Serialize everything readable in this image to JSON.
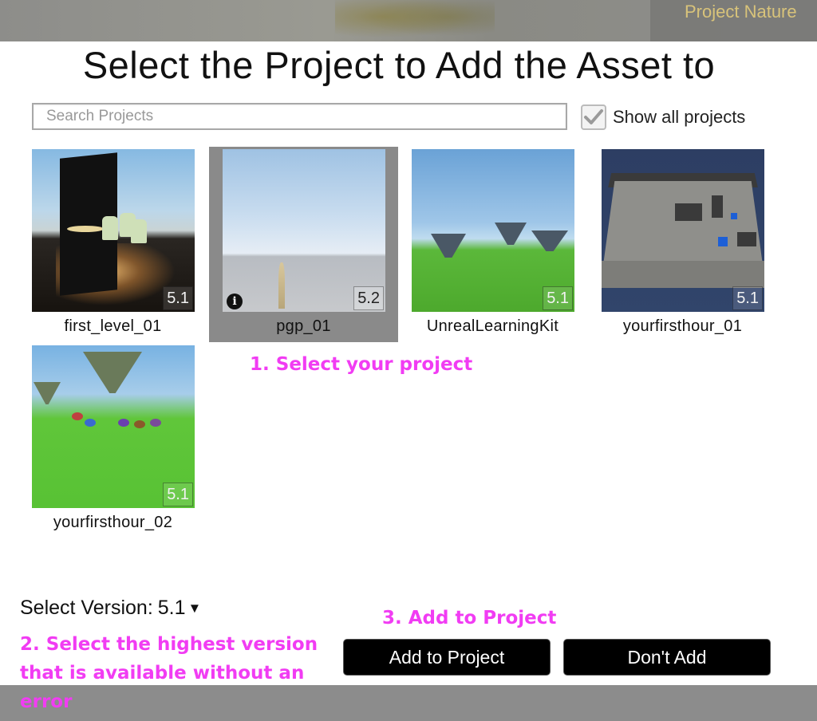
{
  "header": {
    "brand": "Project Nature"
  },
  "dialog": {
    "title": "Select the Project to Add the Asset to",
    "search": {
      "placeholder": "Search Projects",
      "value": ""
    },
    "show_all": {
      "label": "Show all projects",
      "checked": true
    }
  },
  "projects": [
    {
      "name": "first_level_01",
      "version": "5.1",
      "selected": false
    },
    {
      "name": "pgp_01",
      "version": "5.2",
      "selected": true,
      "info_icon": "info-icon"
    },
    {
      "name": "UnrealLearningKit",
      "version": "5.1",
      "selected": false
    },
    {
      "name": "yourfirsthour_01",
      "version": "5.1",
      "selected": false
    },
    {
      "name": "yourfirsthour_02",
      "version": "5.1",
      "selected": false
    }
  ],
  "version_select": {
    "label": "Select Version:",
    "value": "5.1"
  },
  "buttons": {
    "add": "Add to Project",
    "dont_add": "Don't Add"
  },
  "annotations": {
    "step1": "1. Select your project",
    "step2": "2. Select the highest version that is available without an error",
    "step3": "3. Add to Project"
  },
  "colors": {
    "annotation": "#f13cf3",
    "selected_tile": "#8a8a8a",
    "button": "#000000"
  },
  "icons": {
    "checkbox": "checkmark-icon",
    "dropdown": "caret-down-icon",
    "info": "info-icon"
  }
}
